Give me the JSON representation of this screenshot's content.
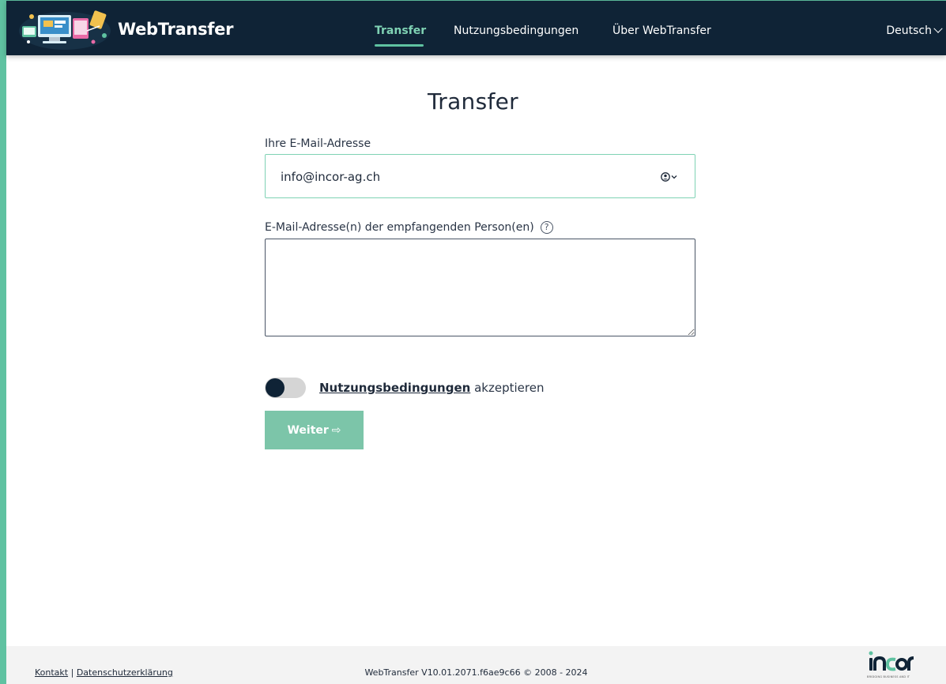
{
  "header": {
    "brand": "WebTransfer",
    "nav": {
      "transfer": "Transfer",
      "terms": "Nutzungsbedingungen",
      "about": "Über WebTransfer"
    },
    "language": "Deutsch"
  },
  "main": {
    "title": "Transfer",
    "sender_label": "Ihre E-Mail-Adresse",
    "sender_value": "info@incor-ag.ch",
    "recipients_label": "E-Mail-Adresse(n) der empfangenden Person(en)",
    "help_symbol": "?",
    "terms_link": "Nutzungsbedingungen",
    "terms_suffix": "akzeptieren",
    "next_button": "Weiter",
    "next_arrow": "⇨",
    "toggle_on": false
  },
  "footer": {
    "contact": "Kontakt",
    "separator": "|",
    "privacy": "Datenschutzerklärung",
    "version": "WebTransfer V10.01.2071.f6ae9c66 © 2008 - 2024",
    "logo_tagline": "BRIDGING BUSINESS AND IT"
  },
  "colors": {
    "header_bg": "#0f2336",
    "accent": "#5fc2a1",
    "button": "#7cc5a9"
  }
}
